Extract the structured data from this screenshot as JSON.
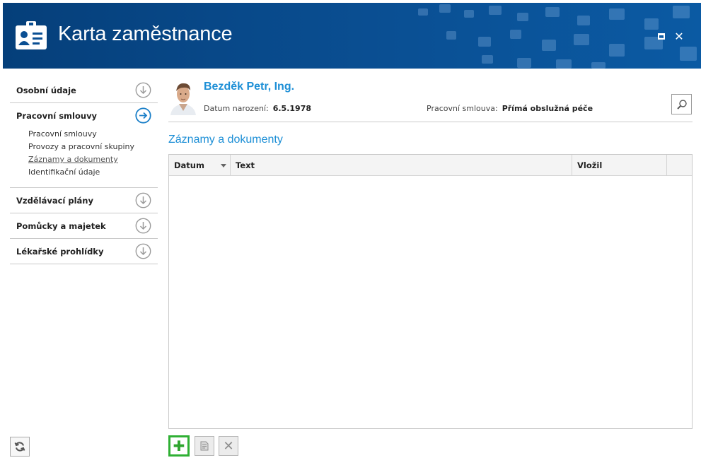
{
  "window": {
    "title": "Karta zaměstnance",
    "icons": {
      "app": "id-card-icon",
      "restore": "restore-icon",
      "close": "close-icon",
      "close_glyph": "✕"
    },
    "colors": {
      "header": "#0a4f93",
      "accent": "#1d8fd6",
      "add_highlight": "#2fb034"
    }
  },
  "sidebar": {
    "sections": [
      {
        "label": "Osobní údaje",
        "icon": "arrow-down-circle-icon"
      },
      {
        "label": "Pracovní smlouvy",
        "icon": "arrow-right-circle-icon",
        "items": [
          "Pracovní smlouvy",
          "Provozy a pracovní skupiny",
          "Záznamy a dokumenty",
          "Identifikační údaje"
        ],
        "active_item": "Záznamy a dokumenty"
      },
      {
        "label": "Vzdělávací plány",
        "icon": "arrow-down-circle-icon"
      },
      {
        "label": "Pomůcky a majetek",
        "icon": "arrow-down-circle-icon"
      },
      {
        "label": "Lékařské prohlídky",
        "icon": "arrow-down-circle-icon"
      }
    ],
    "refresh_icon": "refresh-icon"
  },
  "employee": {
    "name": "Bezděk Petr, Ing.",
    "birth_label": "Datum narození:",
    "birth_value": "6.5.1978",
    "contract_label": "Pracovní smlouva:",
    "contract_value": "Přímá obslužná péče",
    "search_icon": "search-icon"
  },
  "main": {
    "section_title": "Záznamy a dokumenty",
    "grid": {
      "columns": [
        "Datum",
        "Text",
        "Vložil",
        ""
      ],
      "sorted_column": "Datum",
      "rows": []
    },
    "actions": {
      "add": {
        "icon": "plus-icon",
        "glyph": "✚"
      },
      "edit": {
        "icon": "edit-document-icon"
      },
      "delete": {
        "icon": "delete-icon",
        "glyph": "✕"
      }
    }
  }
}
